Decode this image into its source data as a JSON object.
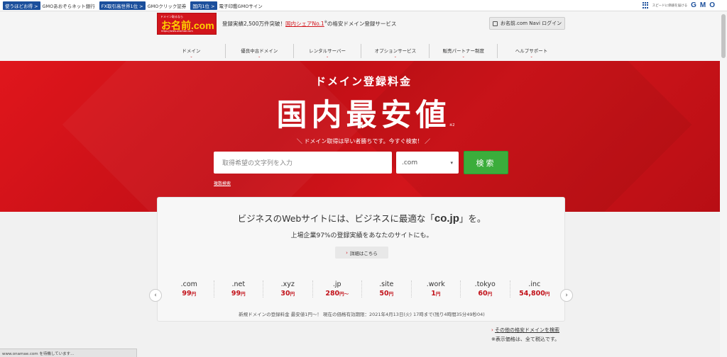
{
  "topbar": {
    "items": [
      {
        "badge": "使うほどお得 >",
        "text": "GMOあおぞらネット銀行"
      },
      {
        "badge": "FX取引高世界1位 >",
        "text": "GMOクリック証券"
      },
      {
        "badge": "国内1位 >",
        "text": "電子印鑑GMOサイン"
      }
    ],
    "gmo_tagline": "スピードに価値を届ける",
    "gmo_logo": "GMO"
  },
  "header": {
    "logo_top": "ドメイン取るなら",
    "logo_main": "お名前.com",
    "logo_url": "https://www.onamae.com",
    "tagline_pre": "登録実績2,500万件突破！",
    "tagline_highlight": "国内シェアNo.1",
    "tagline_note": "※",
    "tagline_post": "の格安ドメイン登録サービス",
    "login_label": "お名前.com Navi ログイン"
  },
  "nav": [
    "ドメイン",
    "優良中古ドメイン",
    "レンタルサーバー",
    "オプションサービス",
    "販売パートナー制度",
    "ヘルプサポート"
  ],
  "hero": {
    "subtitle": "ドメイン登録料金",
    "title": "国内最安値",
    "note": "※2",
    "catch": "＼ ドメイン取得は早い者勝ちです。今すぐ検索！ ／",
    "search_placeholder": "取得希望の文字列を入力",
    "tld_selected": ".com",
    "search_button": "検索",
    "multi_search": "複数検索"
  },
  "card": {
    "headline_pre": "ビジネスのWebサイトには、ビジネスに最適な「",
    "headline_em": "co.jp",
    "headline_post": "」を。",
    "subline": "上場企業97%の登録実績をあなたのサイトにも。",
    "details_label": "詳細はこちら",
    "prices": [
      {
        "tld": ".com",
        "amount": "99",
        "unit": "円"
      },
      {
        "tld": ".net",
        "amount": "99",
        "unit": "円"
      },
      {
        "tld": ".xyz",
        "amount": "30",
        "unit": "円"
      },
      {
        "tld": ".jp",
        "amount": "280",
        "unit": "円〜"
      },
      {
        "tld": ".site",
        "amount": "50",
        "unit": "円"
      },
      {
        "tld": ".work",
        "amount": "1",
        "unit": "円"
      },
      {
        "tld": ".tokyo",
        "amount": "60",
        "unit": "円"
      },
      {
        "tld": ".inc",
        "amount": "54,800",
        "unit": "円"
      }
    ],
    "footer": "新規ドメインの登録料金 最安値1円〜！ 現在の価格有効期限：2021年4月13日(火) 17時まで(残り4時間35分49秒04)"
  },
  "links": {
    "more": "その他の格安ドメインを検索",
    "tax_note": "※表示価格は、全て税込です。"
  },
  "status": "www.onamae.com を待機しています...",
  "colors": {
    "brand_red": "#d2151c",
    "search_green": "#3bad3b",
    "gmo_blue": "#1b4f9c"
  }
}
